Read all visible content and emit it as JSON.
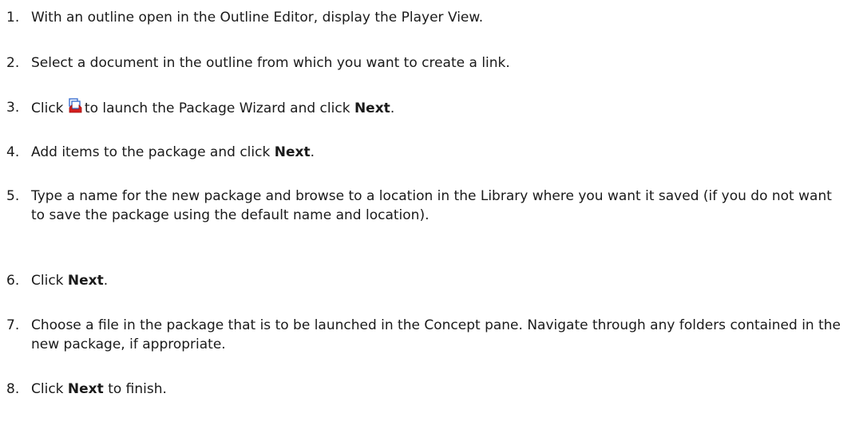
{
  "steps": [
    {
      "number": "1.",
      "text": "With an outline open in the Outline Editor, display the Player View."
    },
    {
      "number": "2.",
      "text": "Select a document in the outline from which you want to create a link."
    },
    {
      "number": "3.",
      "text_before": "Click",
      "icon": "package-wizard-icon",
      "text_after": "to launch the Package Wizard and click",
      "bold": "Next",
      "text_end": "."
    },
    {
      "number": "4.",
      "text_before": "Add items to the package and click",
      "bold": "Next",
      "text_end": "."
    },
    {
      "number": "5.",
      "text": "Type a name for the new package and browse to a location in the Library where you want it saved (if you do not want to save the package using the default name and location)."
    },
    {
      "number": "6.",
      "text_before": "Click",
      "bold": "Next",
      "text_end": "."
    },
    {
      "number": "7.",
      "text": "Choose a file in the package that is to be launched in the Concept pane. Navigate through any folders contained in the new package, if appropriate."
    },
    {
      "number": "8.",
      "text_before": "Click",
      "bold": "Next",
      "text_end": "to finish."
    }
  ],
  "colors": {
    "text": "#1a1a1a",
    "icon_red": "#d42020",
    "icon_blue": "#3b6fd0"
  }
}
